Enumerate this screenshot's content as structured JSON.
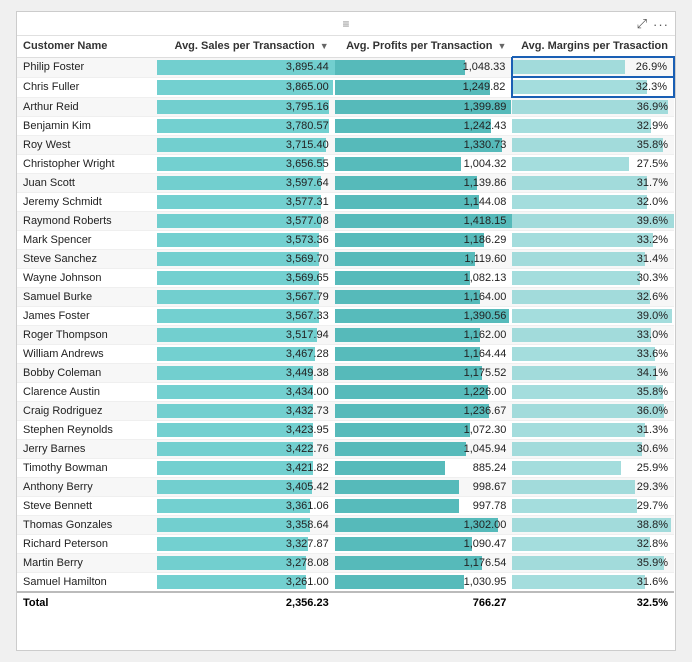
{
  "widget": {
    "drag_icon": "≡",
    "expand_icon": "⤢",
    "more_icon": "···"
  },
  "table": {
    "columns": [
      {
        "key": "name",
        "label": "Customer Name",
        "sortable": false
      },
      {
        "key": "avg_sales",
        "label": "Avg. Sales per Transaction",
        "sortable": true
      },
      {
        "key": "avg_profits",
        "label": "Avg. Profits per Transaction",
        "sortable": true
      },
      {
        "key": "avg_margins",
        "label": "Avg. Margins per Trasaction",
        "sortable": false
      }
    ],
    "rows": [
      {
        "name": "Philip Foster",
        "avg_sales": "3,895.44",
        "avg_profits": "1,048.33",
        "avg_margins": "26.9%",
        "sales_pct": 100,
        "profits_pct": 74,
        "margins_pct": 70,
        "highlight": true
      },
      {
        "name": "Chris Fuller",
        "avg_sales": "3,865.00",
        "avg_profits": "1,249.82",
        "avg_margins": "32.3%",
        "sales_pct": 99,
        "profits_pct": 88,
        "margins_pct": 84,
        "highlight": true
      },
      {
        "name": "Arthur Reid",
        "avg_sales": "3,795.16",
        "avg_profits": "1,399.89",
        "avg_margins": "36.9%",
        "sales_pct": 97,
        "profits_pct": 99,
        "margins_pct": 96
      },
      {
        "name": "Benjamin Kim",
        "avg_sales": "3,780.57",
        "avg_profits": "1,242.43",
        "avg_margins": "32.9%",
        "sales_pct": 97,
        "profits_pct": 88,
        "margins_pct": 86
      },
      {
        "name": "Roy West",
        "avg_sales": "3,715.40",
        "avg_profits": "1,330.73",
        "avg_margins": "35.8%",
        "sales_pct": 95,
        "profits_pct": 94,
        "margins_pct": 93
      },
      {
        "name": "Christopher Wright",
        "avg_sales": "3,656.55",
        "avg_profits": "1,004.32",
        "avg_margins": "27.5%",
        "sales_pct": 94,
        "profits_pct": 71,
        "margins_pct": 72
      },
      {
        "name": "Juan Scott",
        "avg_sales": "3,597.64",
        "avg_profits": "1,139.86",
        "avg_margins": "31.7%",
        "sales_pct": 92,
        "profits_pct": 80,
        "margins_pct": 83
      },
      {
        "name": "Jeremy Schmidt",
        "avg_sales": "3,577.31",
        "avg_profits": "1,144.08",
        "avg_margins": "32.0%",
        "sales_pct": 92,
        "profits_pct": 81,
        "margins_pct": 83
      },
      {
        "name": "Raymond Roberts",
        "avg_sales": "3,577.08",
        "avg_profits": "1,418.15",
        "avg_margins": "39.6%",
        "sales_pct": 92,
        "profits_pct": 100,
        "margins_pct": 100
      },
      {
        "name": "Mark Spencer",
        "avg_sales": "3,573.36",
        "avg_profits": "1,186.29",
        "avg_margins": "33.2%",
        "sales_pct": 91,
        "profits_pct": 84,
        "margins_pct": 87
      },
      {
        "name": "Steve Sanchez",
        "avg_sales": "3,569.70",
        "avg_profits": "1,119.60",
        "avg_margins": "31.4%",
        "sales_pct": 91,
        "profits_pct": 79,
        "margins_pct": 82
      },
      {
        "name": "Wayne Johnson",
        "avg_sales": "3,569.65",
        "avg_profits": "1,082.13",
        "avg_margins": "30.3%",
        "sales_pct": 91,
        "profits_pct": 76,
        "margins_pct": 79
      },
      {
        "name": "Samuel Burke",
        "avg_sales": "3,567.79",
        "avg_profits": "1,164.00",
        "avg_margins": "32.6%",
        "sales_pct": 91,
        "profits_pct": 82,
        "margins_pct": 85
      },
      {
        "name": "James Foster",
        "avg_sales": "3,567.33",
        "avg_profits": "1,390.56",
        "avg_margins": "39.0%",
        "sales_pct": 91,
        "profits_pct": 98,
        "margins_pct": 99
      },
      {
        "name": "Roger Thompson",
        "avg_sales": "3,517.94",
        "avg_profits": "1,162.00",
        "avg_margins": "33.0%",
        "sales_pct": 90,
        "profits_pct": 82,
        "margins_pct": 86
      },
      {
        "name": "William Andrews",
        "avg_sales": "3,467.28",
        "avg_profits": "1,164.44",
        "avg_margins": "33.6%",
        "sales_pct": 89,
        "profits_pct": 82,
        "margins_pct": 88
      },
      {
        "name": "Bobby Coleman",
        "avg_sales": "3,449.38",
        "avg_profits": "1,175.52",
        "avg_margins": "34.1%",
        "sales_pct": 88,
        "profits_pct": 83,
        "margins_pct": 89
      },
      {
        "name": "Clarence Austin",
        "avg_sales": "3,434.00",
        "avg_profits": "1,226.00",
        "avg_margins": "35.8%",
        "sales_pct": 88,
        "profits_pct": 86,
        "margins_pct": 93
      },
      {
        "name": "Craig Rodriguez",
        "avg_sales": "3,432.73",
        "avg_profits": "1,236.67",
        "avg_margins": "36.0%",
        "sales_pct": 88,
        "profits_pct": 87,
        "margins_pct": 94
      },
      {
        "name": "Stephen Reynolds",
        "avg_sales": "3,423.95",
        "avg_profits": "1,072.30",
        "avg_margins": "31.3%",
        "sales_pct": 88,
        "profits_pct": 76,
        "margins_pct": 82
      },
      {
        "name": "Jerry Barnes",
        "avg_sales": "3,422.76",
        "avg_profits": "1,045.94",
        "avg_margins": "30.6%",
        "sales_pct": 88,
        "profits_pct": 74,
        "margins_pct": 80
      },
      {
        "name": "Timothy Bowman",
        "avg_sales": "3,421.82",
        "avg_profits": "885.24",
        "avg_margins": "25.9%",
        "sales_pct": 88,
        "profits_pct": 62,
        "margins_pct": 67
      },
      {
        "name": "Anthony Berry",
        "avg_sales": "3,405.42",
        "avg_profits": "998.67",
        "avg_margins": "29.3%",
        "sales_pct": 87,
        "profits_pct": 70,
        "margins_pct": 76
      },
      {
        "name": "Steve Bennett",
        "avg_sales": "3,361.06",
        "avg_profits": "997.78",
        "avg_margins": "29.7%",
        "sales_pct": 86,
        "profits_pct": 70,
        "margins_pct": 77
      },
      {
        "name": "Thomas Gonzales",
        "avg_sales": "3,358.64",
        "avg_profits": "1,302.00",
        "avg_margins": "38.8%",
        "sales_pct": 86,
        "profits_pct": 92,
        "margins_pct": 98
      },
      {
        "name": "Richard Peterson",
        "avg_sales": "3,327.87",
        "avg_profits": "1,090.47",
        "avg_margins": "32.8%",
        "sales_pct": 85,
        "profits_pct": 77,
        "margins_pct": 85
      },
      {
        "name": "Martin Berry",
        "avg_sales": "3,278.08",
        "avg_profits": "1,176.54",
        "avg_margins": "35.9%",
        "sales_pct": 84,
        "profits_pct": 83,
        "margins_pct": 94
      },
      {
        "name": "Samuel Hamilton",
        "avg_sales": "3,261.00",
        "avg_profits": "1,030.95",
        "avg_margins": "31.6%",
        "sales_pct": 84,
        "profits_pct": 73,
        "margins_pct": 82
      }
    ],
    "footer": {
      "label": "Total",
      "avg_sales": "2,356.23",
      "avg_profits": "766.27",
      "avg_margins": "32.5%"
    }
  }
}
